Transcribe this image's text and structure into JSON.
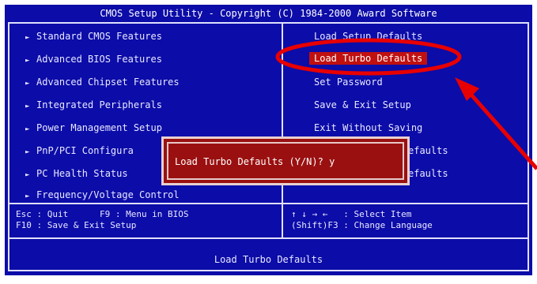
{
  "window": {
    "title": "CMOS Setup Utility - Copyright (C) 1984-2000 Award Software"
  },
  "left_menu": [
    {
      "label": "Standard CMOS Features"
    },
    {
      "label": "Advanced BIOS Features"
    },
    {
      "label": "Advanced Chipset Features"
    },
    {
      "label": "Integrated Peripherals"
    },
    {
      "label": "Power Management Setup"
    },
    {
      "label": "PnP/PCI Configura"
    },
    {
      "label": "PC Health Status"
    },
    {
      "label": "Frequency/Voltage Control"
    }
  ],
  "right_menu": [
    {
      "label": "Load Setup Defaults"
    },
    {
      "label": "Load Turbo Defaults"
    },
    {
      "label": "Set Password"
    },
    {
      "label": "Save & Exit Setup"
    },
    {
      "label": "Exit Without Saving"
    },
    {
      "label": "efaults"
    },
    {
      "label": "efaults"
    }
  ],
  "help": {
    "left": "Esc : Quit      F9 : Menu in BIOS\nF10 : Save & Exit Setup",
    "right": "↑ ↓ → ←   : Select Item\n(Shift)F3 : Change Language"
  },
  "status_bar": {
    "text": "Load Turbo Defaults"
  },
  "dialog": {
    "prompt": "Load Turbo Defaults (Y/N)? y"
  },
  "icons": {
    "menu_arrow": "►"
  },
  "colors": {
    "background": "#0c0ca8",
    "selected": "#c01010",
    "dialog": "#9a1010",
    "highlight_annotation": "#e80000"
  }
}
